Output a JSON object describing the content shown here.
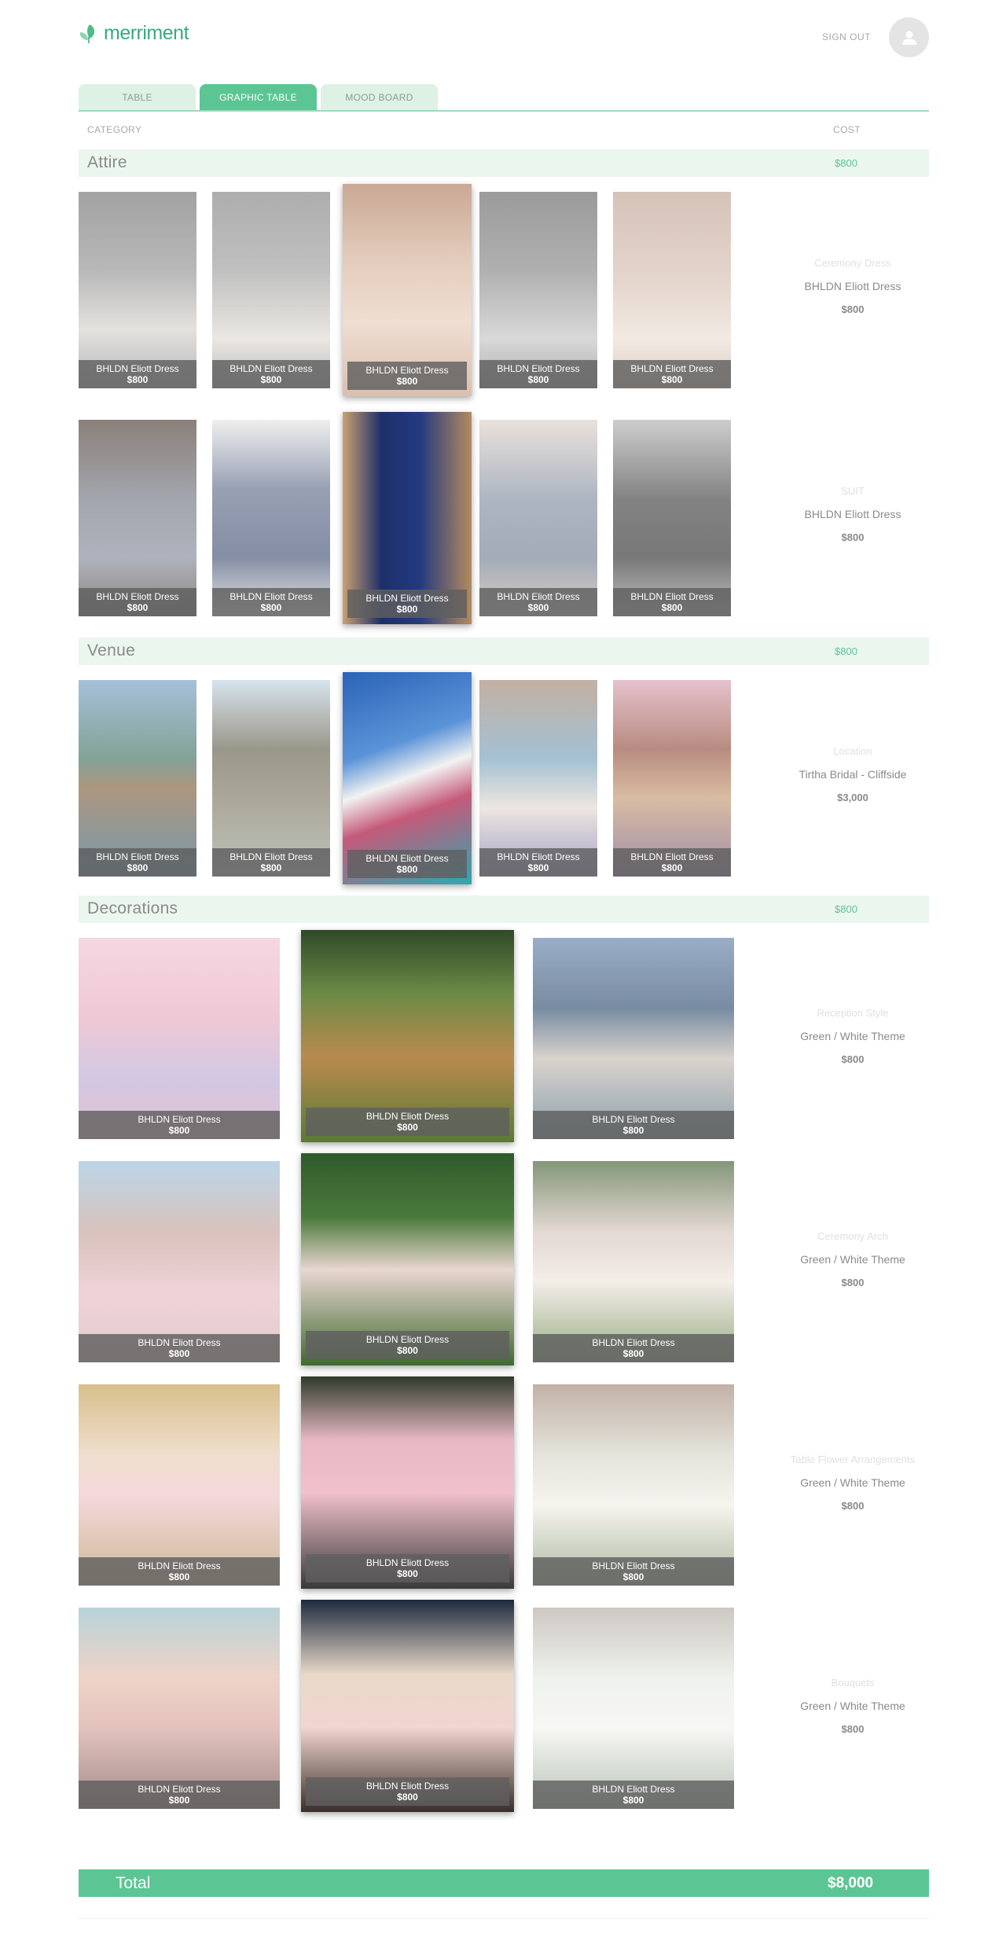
{
  "brand": {
    "name": "merriment",
    "accent": "#5cc594"
  },
  "header": {
    "signout_label": "SIGN OUT",
    "avatar_icon": "user-icon"
  },
  "tabs": [
    {
      "label": "TABLE",
      "active": false
    },
    {
      "label": "GRAPHIC TABLE",
      "active": true
    },
    {
      "label": "MOOD BOARD",
      "active": false
    }
  ],
  "columns": {
    "category": "CATEGORY",
    "cost": "COST"
  },
  "sections": {
    "attire": {
      "title": "Attire",
      "cost": "$800"
    },
    "venue": {
      "title": "Venue",
      "cost": "$800"
    },
    "decorations": {
      "title": "Decorations",
      "cost": "$800"
    }
  },
  "caption": {
    "name": "BHLDN Eliott Dress",
    "price": "$800"
  },
  "rows": {
    "ceremony_dress": {
      "category": "Ceremony Dress",
      "selection": "BHLDN Eliott Dress",
      "price": "$800"
    },
    "suit": {
      "category": "SUIT",
      "selection": "BHLDN Eliott Dress",
      "price": "$800"
    },
    "location": {
      "category": "Location",
      "selection": "Tirtha Bridal - Cliffside",
      "price": "$3,000"
    },
    "reception_style": {
      "category": "Reception Style",
      "selection": "Green / White Theme",
      "price": "$800"
    },
    "ceremony_arch": {
      "category": "Ceremony Arch",
      "selection": "Green / White Theme",
      "price": "$800"
    },
    "table_flowers": {
      "category": "Table Flower Arrangements",
      "selection": "Green / White Theme",
      "price": "$800"
    },
    "bouquets": {
      "category": "Bouquets",
      "selection": "Green / White Theme",
      "price": "$800"
    }
  },
  "total": {
    "label": "Total",
    "value": "$8,000"
  }
}
